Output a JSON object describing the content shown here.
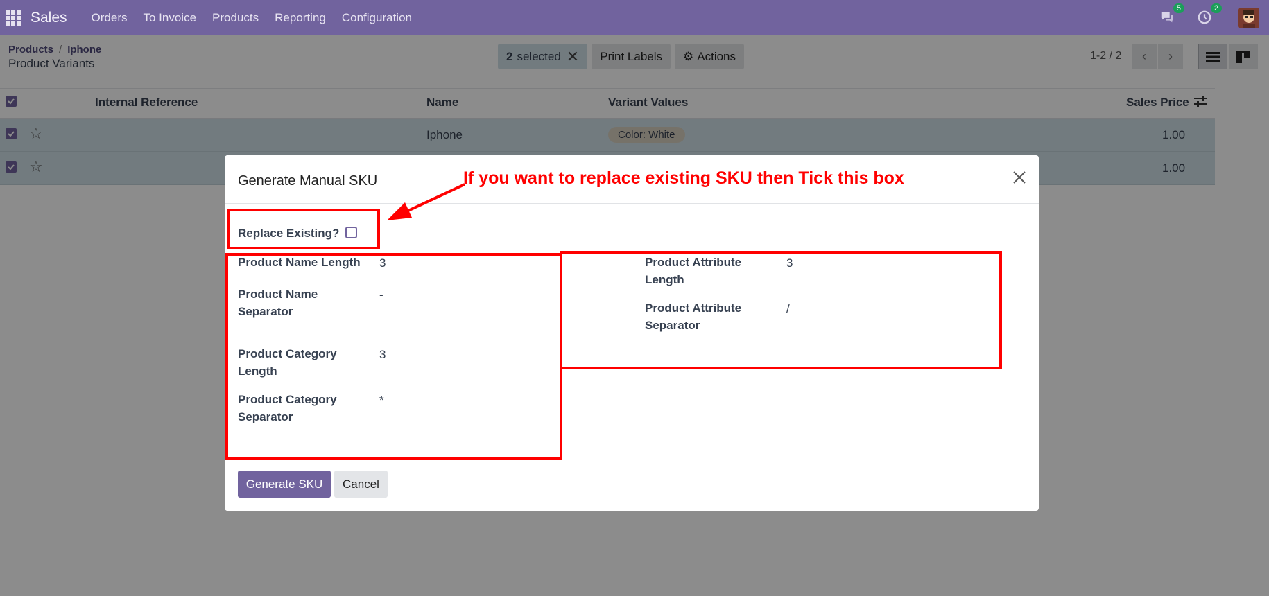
{
  "navbar": {
    "app_name": "Sales",
    "menu": [
      "Orders",
      "To Invoice",
      "Products",
      "Reporting",
      "Configuration"
    ],
    "messages_count": "5",
    "activities_count": "2",
    "color": "#71639e"
  },
  "control_panel": {
    "breadcrumb": [
      "Products",
      "Iphone"
    ],
    "title": "Product Variants",
    "selected_count": "2",
    "selected_label": "selected",
    "print_labels": "Print Labels",
    "actions": "Actions",
    "pager": "1-2 / 2"
  },
  "list": {
    "columns": [
      "Internal Reference",
      "Name",
      "Variant Values",
      "Sales Price"
    ],
    "rows": [
      {
        "internal_reference": "",
        "name": "Iphone",
        "variant_values": "Color: White",
        "sales_price": "1.00"
      },
      {
        "internal_reference": "",
        "name": "",
        "variant_values": "",
        "sales_price": "1.00"
      }
    ]
  },
  "modal": {
    "title": "Generate Manual SKU",
    "replace_existing_label": "Replace Existing?",
    "replace_existing_checked": false,
    "left_fields": [
      {
        "label_l1": "Product Name Length",
        "label_l2": "",
        "value": "3"
      },
      {
        "label_l1": "Product Name",
        "label_l2": "Separator",
        "value": "-"
      },
      {
        "label_l1": "Product Category",
        "label_l2": "Length",
        "value": "3"
      },
      {
        "label_l1": "Product Category",
        "label_l2": "Separator",
        "value": "*"
      }
    ],
    "right_fields": [
      {
        "label_l1": "Product Attribute",
        "label_l2": "Length",
        "value": "3"
      },
      {
        "label_l1": "Product Attribute",
        "label_l2": "Separator",
        "value": "/"
      }
    ],
    "generate_button": "Generate SKU",
    "cancel_button": "Cancel"
  },
  "annotation": {
    "text": "If you want to replace existing SKU then Tick this box",
    "color": "#ff0000"
  }
}
